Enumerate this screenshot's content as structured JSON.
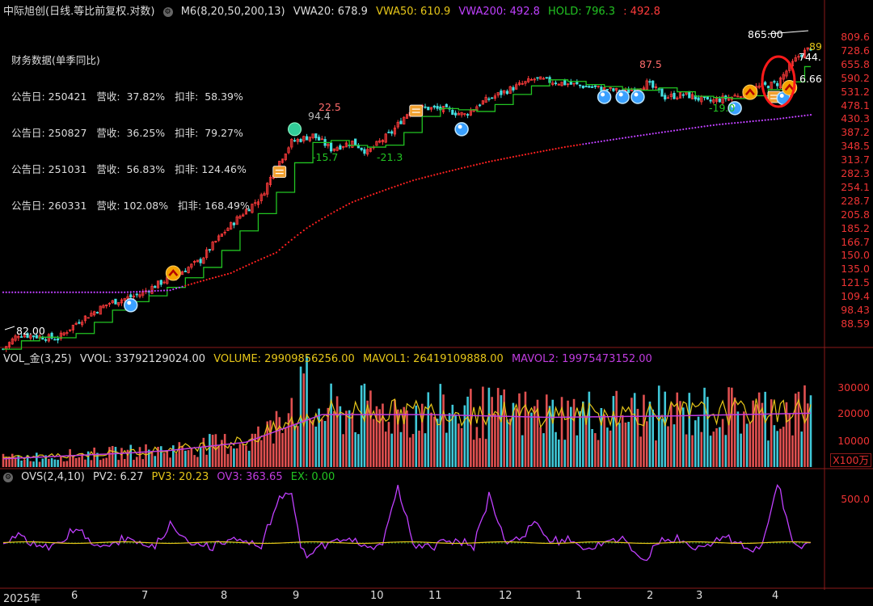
{
  "header": {
    "title": "中际旭创(日线.等比前复权.对数)",
    "m6": "M6(8,20,50,200,13)",
    "vwa20": "VWA20: 678.9",
    "vwa50": "VWA50: 610.9",
    "vwa200": "VWA200: 492.8",
    "hold": "HOLD: 796.3",
    "hold_extra": ": 492.8"
  },
  "financial": {
    "title": "财务数据(单季同比)",
    "rows": [
      "公告日: 250421   营收:  37.82%   扣非:  58.39%",
      "公告日: 250827   营收:  36.25%   扣非:  79.27%",
      "公告日: 251031   营收:  56.83%   扣非: 124.46%",
      "公告日: 260331   营收: 102.08%   扣非: 168.49%"
    ]
  },
  "vol_header": {
    "name": "VOL_金(3,25)",
    "vvol": "VVOL: 33792129024.00",
    "volume": "VOLUME: 29909856256.00",
    "mavol1": "MAVOL1: 26419109888.00",
    "mavol2": "MAVOL2: 19975473152.00"
  },
  "ovs_header": {
    "name": "OVS(2,4,10)",
    "pv2": "PV2: 6.27",
    "pv3": "PV3: 20.23",
    "ov3": "OV3: 363.65",
    "ex": "EX: 0.00"
  },
  "annotations": {
    "high": "865.00",
    "low": "82.00",
    "a1": "22.5",
    "a2": "94.4",
    "a3": "-15.7",
    "a4": "-21.3",
    "a5": "87.5",
    "a6": "-19.0",
    "a7": "744.",
    "a8": "6.66",
    "a9": "89"
  },
  "chart_data": {
    "type": "candlestick",
    "price_axis_labels": [
      "809.6",
      "728.6",
      "655.8",
      "590.2",
      "531.2",
      "478.1",
      "430.3",
      "387.2",
      "348.5",
      "313.7",
      "282.3",
      "254.1",
      "228.7",
      "205.8",
      "185.2",
      "166.7",
      "150.0",
      "135.0",
      "121.5",
      "109.4",
      "98.43",
      "88.59"
    ],
    "volume_axis_labels": [
      "30000",
      "20000",
      "10000"
    ],
    "volume_unit": "X100万",
    "ovs_axis_labels": [
      "500.0"
    ],
    "x_labels": [
      "2025年",
      "6",
      "7",
      "8",
      "9",
      "10",
      "11",
      "12",
      "1",
      "2",
      "3",
      "4"
    ],
    "price_range": [
      82.0,
      865.0
    ],
    "scale": "log",
    "close_keypoints": [
      {
        "t": 0,
        "v": 85
      },
      {
        "t": 5,
        "v": 95
      },
      {
        "t": 18,
        "v": 92
      },
      {
        "t": 25,
        "v": 105
      },
      {
        "t": 35,
        "v": 120
      },
      {
        "t": 45,
        "v": 128
      },
      {
        "t": 52,
        "v": 140
      },
      {
        "t": 58,
        "v": 150
      },
      {
        "t": 65,
        "v": 165
      },
      {
        "t": 75,
        "v": 215
      },
      {
        "t": 85,
        "v": 265
      },
      {
        "t": 95,
        "v": 400
      },
      {
        "t": 102,
        "v": 420
      },
      {
        "t": 108,
        "v": 380
      },
      {
        "t": 115,
        "v": 400
      },
      {
        "t": 120,
        "v": 370
      },
      {
        "t": 128,
        "v": 430
      },
      {
        "t": 135,
        "v": 520
      },
      {
        "t": 145,
        "v": 510
      },
      {
        "t": 152,
        "v": 490
      },
      {
        "t": 158,
        "v": 540
      },
      {
        "t": 168,
        "v": 600
      },
      {
        "t": 175,
        "v": 640
      },
      {
        "t": 185,
        "v": 620
      },
      {
        "t": 195,
        "v": 600
      },
      {
        "t": 205,
        "v": 580
      },
      {
        "t": 212,
        "v": 620
      },
      {
        "t": 218,
        "v": 560
      },
      {
        "t": 225,
        "v": 570
      },
      {
        "t": 232,
        "v": 540
      },
      {
        "t": 240,
        "v": 560
      },
      {
        "t": 248,
        "v": 600
      },
      {
        "t": 255,
        "v": 620
      },
      {
        "t": 262,
        "v": 760
      },
      {
        "t": 266,
        "v": 810
      }
    ],
    "ma_red_keypoints": [
      {
        "t": 0,
        "v": 130
      },
      {
        "t": 40,
        "v": 130
      },
      {
        "t": 55,
        "v": 132
      },
      {
        "t": 75,
        "v": 150
      },
      {
        "t": 90,
        "v": 175
      },
      {
        "t": 100,
        "v": 210
      },
      {
        "t": 115,
        "v": 255
      },
      {
        "t": 135,
        "v": 300
      },
      {
        "t": 160,
        "v": 345
      },
      {
        "t": 185,
        "v": 385
      },
      {
        "t": 210,
        "v": 420
      },
      {
        "t": 235,
        "v": 455
      },
      {
        "t": 255,
        "v": 475
      },
      {
        "t": 266,
        "v": 490
      }
    ],
    "volume_avg_keypoints": [
      {
        "t": 0,
        "v": 3000
      },
      {
        "t": 40,
        "v": 5000
      },
      {
        "t": 55,
        "v": 6000
      },
      {
        "t": 80,
        "v": 9000
      },
      {
        "t": 95,
        "v": 15000
      },
      {
        "t": 105,
        "v": 19000
      },
      {
        "t": 140,
        "v": 19000
      },
      {
        "t": 180,
        "v": 18000
      },
      {
        "t": 220,
        "v": 18500
      },
      {
        "t": 266,
        "v": 19500
      }
    ],
    "ovs_spikes": [
      {
        "t": 25,
        "v": 120
      },
      {
        "t": 55,
        "v": 180
      },
      {
        "t": 90,
        "v": 400
      },
      {
        "t": 95,
        "v": 560
      },
      {
        "t": 98,
        "v": -250
      },
      {
        "t": 130,
        "v": 520
      },
      {
        "t": 160,
        "v": 500
      },
      {
        "t": 175,
        "v": 300
      },
      {
        "t": 210,
        "v": -160
      },
      {
        "t": 255,
        "v": 550
      }
    ]
  },
  "colors": {
    "up": "#ff3b3b",
    "down": "#44e0e0",
    "ma_green": "#22c422",
    "ma_red": "#ff2020",
    "ma_purple": "#c040ff",
    "vol_yellow": "#e6c619",
    "vol_purple": "#c13ce0",
    "gold": "#e6c619",
    "border": "#8b1a1a"
  }
}
